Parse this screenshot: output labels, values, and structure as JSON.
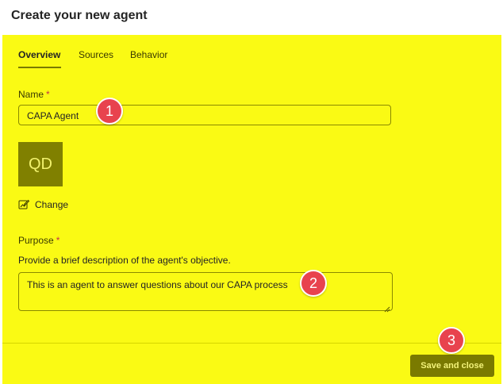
{
  "header": {
    "title": "Create your new agent"
  },
  "tabs": [
    {
      "label": "Overview",
      "active": true
    },
    {
      "label": "Sources",
      "active": false
    },
    {
      "label": "Behavior",
      "active": false
    }
  ],
  "name_field": {
    "label": "Name",
    "required_mark": "*",
    "value": "CAPA Agent"
  },
  "avatar": {
    "initials": "QD",
    "color": "#808000"
  },
  "change_link": {
    "icon": "edit-image-icon",
    "label": "Change"
  },
  "purpose_field": {
    "label": "Purpose",
    "required_mark": "*",
    "hint": "Provide a brief description of the agent's objective.",
    "value": "This is an agent to answer questions about our CAPA process"
  },
  "footer": {
    "save_label": "Save and close"
  },
  "callouts": [
    {
      "number": "1"
    },
    {
      "number": "2"
    },
    {
      "number": "3"
    }
  ],
  "colors": {
    "highlight": "#fafa14",
    "accent": "#7a7a00",
    "callout": "#e8434e",
    "required": "#c4314b"
  }
}
